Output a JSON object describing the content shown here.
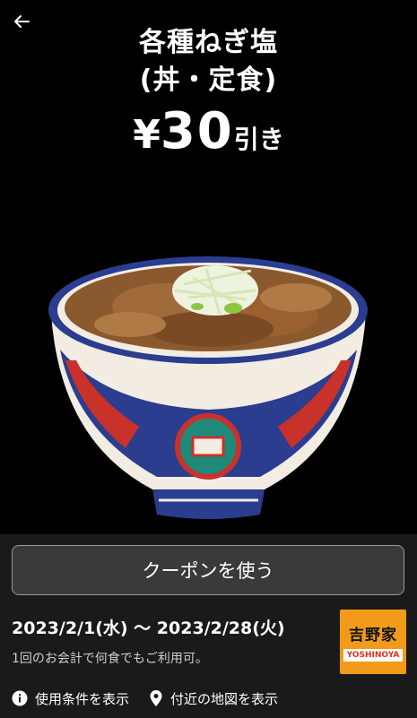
{
  "header": {
    "title_line1": "各種ねぎ塩",
    "title_line2": "(丼・定食)",
    "discount_yen": "¥",
    "discount_amount": "30",
    "discount_suffix": "引き"
  },
  "coupon": {
    "use_button_label": "クーポンを使う",
    "period": "2023/2/1(水) 〜 2023/2/28(火)",
    "note": "1回のお会計で何食でもご利用可。"
  },
  "brand": {
    "logo_jp": "吉野家",
    "logo_en": "YOSHINOYA"
  },
  "footer": {
    "terms_label": "使用条件を表示",
    "map_label": "付近の地図を表示"
  },
  "icons": {
    "back": "arrow-left-icon",
    "terms": "info-icon",
    "map": "map-pin-icon"
  },
  "colors": {
    "background": "#000000",
    "panel": "#1a1a1a",
    "button_bg": "#3a3a3a",
    "brand_orange": "#f29a1a"
  }
}
